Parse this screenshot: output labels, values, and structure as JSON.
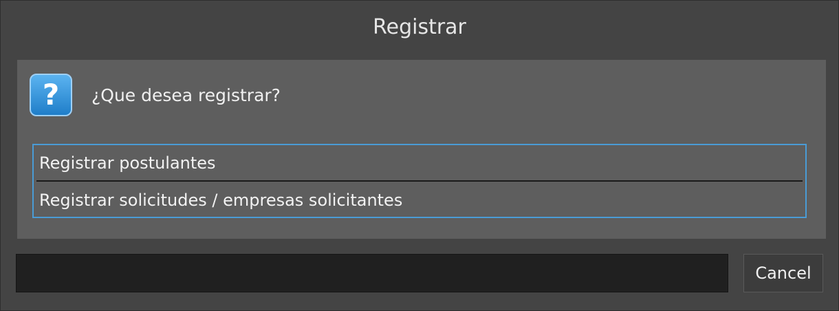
{
  "dialog": {
    "title": "Registrar",
    "question": "¿Que desea registrar?",
    "icon": "question-icon",
    "icon_glyph": "?",
    "options": [
      {
        "label": "Registrar postulantes"
      },
      {
        "label": "Registrar solicitudes / empresas solicitantes"
      }
    ],
    "filter": {
      "value": "",
      "placeholder": ""
    },
    "cancel_label": "Cancel"
  },
  "colors": {
    "background": "#444444",
    "content_panel": "#5e5e5e",
    "list_border": "#4a9cd6",
    "icon_blue": "#2d8fd8",
    "text": "#f0f0f0"
  }
}
